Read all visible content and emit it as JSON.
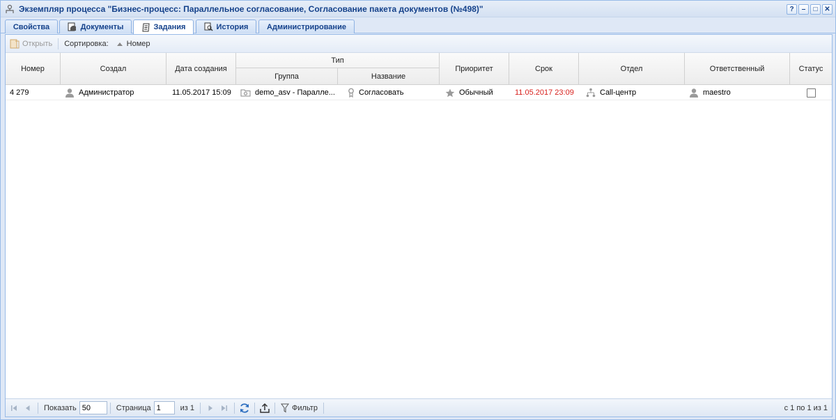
{
  "window": {
    "title": "Экземпляр процесса \"Бизнес-процесс: Параллельное согласование, Согласование пакета документов (№498)\"",
    "tools": [
      "?",
      "–",
      "□",
      "✕"
    ]
  },
  "tabs": [
    {
      "label": "Свойства"
    },
    {
      "label": "Документы"
    },
    {
      "label": "Задания"
    },
    {
      "label": "История"
    },
    {
      "label": "Администрирование"
    }
  ],
  "toolbar": {
    "open_label": "Открыть",
    "sort_label": "Сортировка:",
    "sort_field": "Номер"
  },
  "grid": {
    "columns": {
      "number": "Номер",
      "creator": "Создал",
      "created": "Дата создания",
      "type": "Тип",
      "group": "Группа",
      "name": "Название",
      "priority": "Приоритет",
      "deadline": "Срок",
      "department": "Отдел",
      "responsible": "Ответственный",
      "status": "Статус"
    },
    "rows": [
      {
        "number": "4 279",
        "creator": "Администратор",
        "created": "11.05.2017 15:09",
        "group": "demo_asv - Паралле...",
        "name": "Согласовать",
        "priority": "Обычный",
        "deadline": "11.05.2017 23:09",
        "department": "Call-центр",
        "responsible": "maestro",
        "status_checked": false
      }
    ]
  },
  "pager": {
    "show_label": "Показать",
    "page_size": "50",
    "page_label": "Страница",
    "page_value": "1",
    "of_label": "из 1",
    "filter_label": "Фильтр",
    "info": "с 1 по 1 из 1"
  },
  "colors": {
    "accent": "#15428b",
    "overdue": "#d8201c",
    "border": "#99bbe8"
  }
}
